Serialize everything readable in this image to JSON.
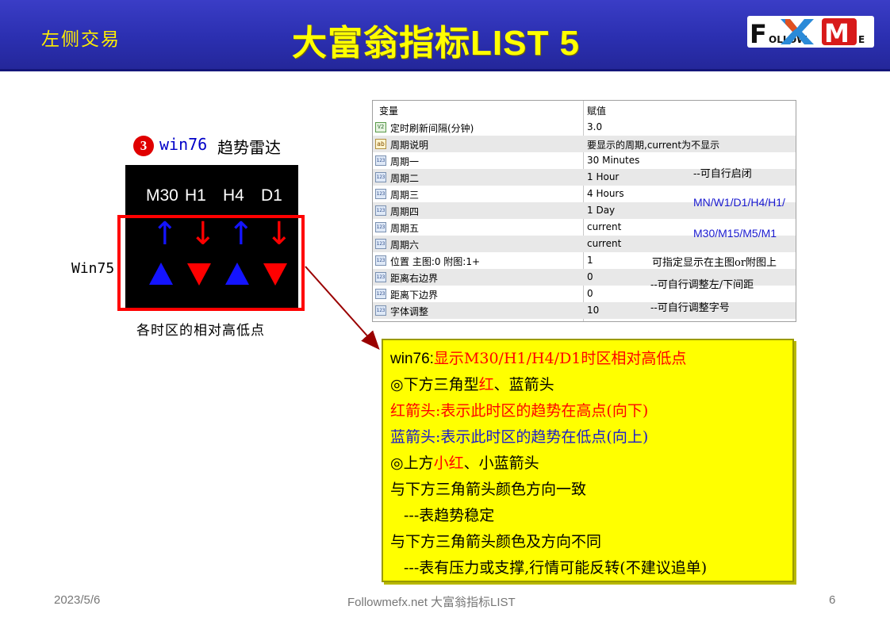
{
  "header": {
    "left_label": "左侧交易",
    "title": "大富翁指标LIST 5",
    "logo_text": "F    OLLOW    M    E"
  },
  "left": {
    "badge": "3",
    "indicator_name": "win76",
    "indicator_cn": "趋势雷达",
    "timeframes": [
      "M30",
      "H1",
      "H4",
      "D1"
    ],
    "arrows": [
      "↑",
      "↓",
      "↑",
      "↓"
    ],
    "side_label": "Win75",
    "caption": "各时区的相对高低点"
  },
  "table": {
    "headers": [
      "变量",
      "赋值"
    ],
    "rows": [
      {
        "icon": "V2",
        "name": "定时刷新间隔(分钟)",
        "value": "3.0"
      },
      {
        "icon": "ab",
        "name": "周期说明",
        "value": "要显示的周期,current为不显示"
      },
      {
        "icon": "123",
        "name": "周期一",
        "value": "30 Minutes"
      },
      {
        "icon": "123",
        "name": "周期二",
        "value": "1 Hour"
      },
      {
        "icon": "123",
        "name": "周期三",
        "value": "4 Hours"
      },
      {
        "icon": "123",
        "name": "周期四",
        "value": "1 Day"
      },
      {
        "icon": "123",
        "name": "周期五",
        "value": "current"
      },
      {
        "icon": "123",
        "name": "周期六",
        "value": "current"
      },
      {
        "icon": "123",
        "name": "位置 主图:0 附图:1+",
        "value": "1"
      },
      {
        "icon": "123",
        "name": "距离右边界",
        "value": "0"
      },
      {
        "icon": "123",
        "name": "距离下边界",
        "value": "0"
      },
      {
        "icon": "123",
        "name": "字体调整",
        "value": "10"
      }
    ]
  },
  "annotations": {
    "enable_hint": "--可自行启闭",
    "periods_line1": "MN/W1/D1/H4/H1/",
    "periods_line2": "M30/M15/M5/M1",
    "position_hint": "可指定显示在主图or附图上",
    "margin_hint": "--可自行调整左/下间距",
    "font_hint": "--可自行调整字号"
  },
  "explanation": {
    "line1_a": "win76:",
    "line1_b": "显示M30/H1/H4/D1时区相对高低点",
    "line2_a": "◎下方三角型",
    "line2_b": "红",
    "line2_c": "、蓝箭头",
    "line3": "红箭头:表示此时区的趋势在高点(向下)",
    "line4": "蓝箭头:表示此时区的趋势在低点(向上)",
    "line5_a": "◎上方",
    "line5_b": "小红",
    "line5_c": "、小蓝箭头",
    "line6": "与下方三角箭头颜色方向一致",
    "line7": "---表趋势稳定",
    "line8": "与下方三角箭头颜色及方向不同",
    "line9": "---表有压力或支撑,行情可能反转(不建议追单)"
  },
  "footer": {
    "date": "2023/5/6",
    "center": "Followmefx.net 大富翁指标LIST",
    "page": "6"
  },
  "colors": {
    "header_bg": "#2b2fb0",
    "header_text": "#ffff00",
    "arrow_up": "#1414ff",
    "arrow_down": "#ff0000",
    "highlight_box": "#ff0000",
    "note_bg": "#ffff00"
  }
}
